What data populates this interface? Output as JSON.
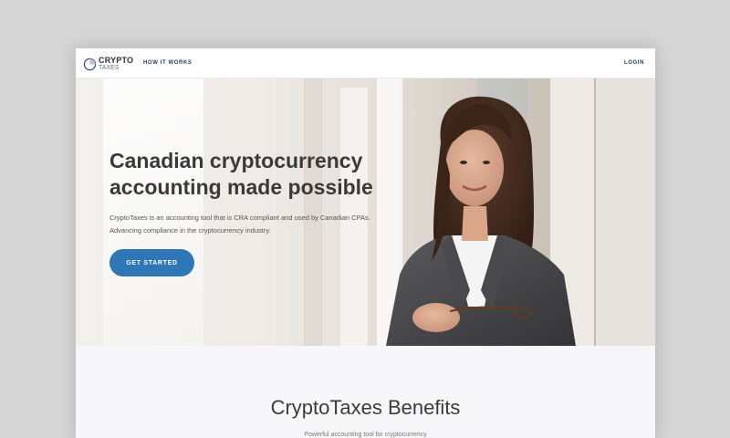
{
  "nav": {
    "logo_top": "CRYPTO",
    "logo_bottom": "TAXES",
    "how_it_works": "HOW IT WORKS",
    "login": "LOGIN"
  },
  "hero": {
    "title": "Canadian cryptocurrency accounting made possible",
    "description": "CryptoTaxes is an accounting tool that is CRA compliant and used by Canadian CPAs. Advancing compliance in the cryptocurrency industry.",
    "cta_label": "GET STARTED"
  },
  "benefits": {
    "title": "CryptoTaxes Benefits",
    "subtitle": "Powerful accounting tool for cryptocurrency"
  },
  "colors": {
    "accent": "#2e76b6",
    "nav_text": "#2b3a67",
    "heading": "#3a3a3a",
    "backdrop": "#d6d6d6"
  },
  "icons": {
    "logo": "pie-chart-logo-icon"
  }
}
